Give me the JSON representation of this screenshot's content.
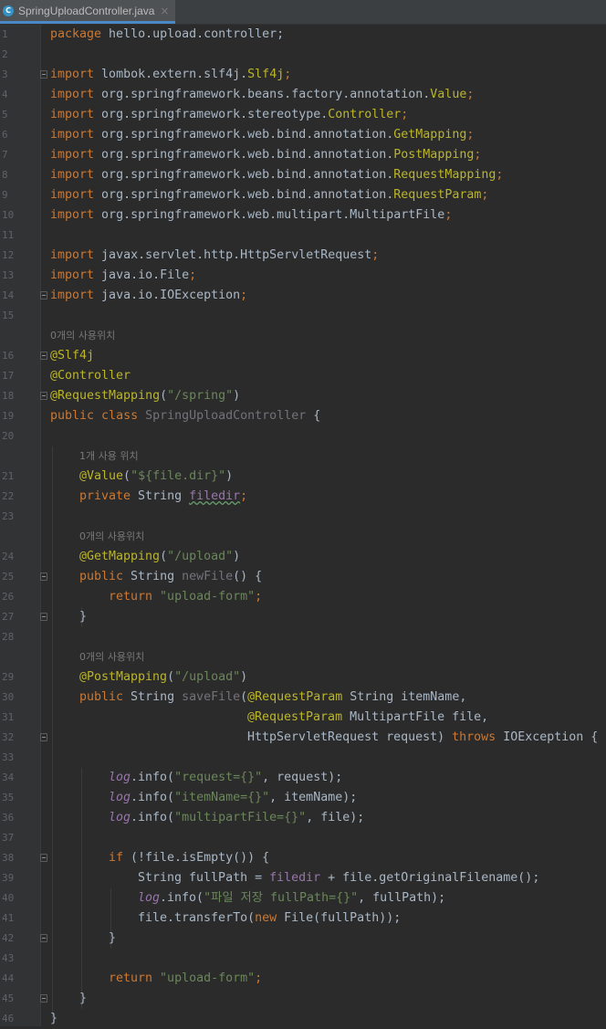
{
  "tab": {
    "filename": "SpringUploadController.java",
    "close": "×"
  },
  "hints": {
    "class_usages": "0개의 사용위치",
    "filedir_usages": "1개 사용 위치",
    "newfile_usages": "0개의 사용위치",
    "savefile_usages": "0개의 사용위치"
  },
  "lines": [
    "1",
    "2",
    "3",
    "4",
    "5",
    "6",
    "7",
    "8",
    "9",
    "10",
    "11",
    "12",
    "13",
    "14",
    "15",
    "16",
    "17",
    "18",
    "19",
    "20",
    "21",
    "22",
    "23",
    "24",
    "25",
    "26",
    "27",
    "28",
    "29",
    "30",
    "31",
    "32",
    "33",
    "34",
    "35",
    "36",
    "37",
    "38",
    "39",
    "40",
    "41",
    "42",
    "43",
    "44",
    "45",
    "46"
  ],
  "code": {
    "package_kw": "package",
    "package_name": " hello.upload.controller;",
    "imports": [
      {
        "kw": "import",
        "path": " lombok.extern.slf4j.",
        "cls": "Slf4j",
        "end": ";"
      },
      {
        "kw": "import",
        "path": " org.springframework.beans.factory.annotation.",
        "cls": "Value",
        "end": ";"
      },
      {
        "kw": "import",
        "path": " org.springframework.stereotype.",
        "cls": "Controller",
        "end": ";"
      },
      {
        "kw": "import",
        "path": " org.springframework.web.bind.annotation.",
        "cls": "GetMapping",
        "end": ";"
      },
      {
        "kw": "import",
        "path": " org.springframework.web.bind.annotation.",
        "cls": "PostMapping",
        "end": ";"
      },
      {
        "kw": "import",
        "path": " org.springframework.web.bind.annotation.",
        "cls": "RequestMapping",
        "end": ";"
      },
      {
        "kw": "import",
        "path": " org.springframework.web.bind.annotation.",
        "cls": "RequestParam",
        "end": ";"
      },
      {
        "kw": "import",
        "path": " org.springframework.web.multipart.MultipartFile",
        "cls": "",
        "end": ";"
      },
      {
        "kw": "import",
        "path": " javax.servlet.http.HttpServletRequest",
        "cls": "",
        "end": ";"
      },
      {
        "kw": "import",
        "path": " java.io.File",
        "cls": "",
        "end": ";"
      },
      {
        "kw": "import",
        "path": " java.io.IOException",
        "cls": "",
        "end": ";"
      }
    ],
    "ann_slf4j": "@Slf4j",
    "ann_controller": "@Controller",
    "ann_reqmap": "@RequestMapping",
    "reqmap_open": "(",
    "reqmap_str": "\"/spring\"",
    "reqmap_close": ")",
    "kw_public": "public",
    "kw_class": " class ",
    "class_name": "SpringUploadController",
    "class_open": " {",
    "ann_value": "@Value",
    "value_open": "(",
    "value_str": "\"${file.dir}\"",
    "value_close": ")",
    "kw_private": "private",
    "type_string": " String ",
    "field_filedir": "filedir",
    "semi": ";",
    "ann_get": "@GetMapping",
    "get_open": "(",
    "get_str": "\"/upload\"",
    "get_close": ")",
    "newfile_public": "public",
    "newfile_type": " String ",
    "newfile_name": "newFile",
    "newfile_rest": "() {",
    "kw_return": "return",
    "return_str": " \"upload-form\"",
    "return_semi": ";",
    "close_brace": "}",
    "ann_post": "@PostMapping",
    "post_open": "(",
    "post_str": "\"/upload\"",
    "post_close": ")",
    "savefile_public": "public",
    "savefile_type": " String ",
    "savefile_name": "saveFile",
    "savefile_paren": "(",
    "ann_reqparam": "@RequestParam",
    "param1_rest": " String itemName,",
    "ann_reqparam2": "@RequestParam",
    "param2_rest": " MultipartFile file,",
    "param3": "HttpServletRequest request) ",
    "kw_throws": "throws",
    "throws_rest": " IOException {",
    "log": "log",
    "info_call": ".info(",
    "log1_str": "\"request={}\"",
    "log1_rest": ", request);",
    "log2_str": "\"itemName={}\"",
    "log2_rest": ", itemName);",
    "log3_str": "\"multipartFile={}\"",
    "log3_rest": ", file);",
    "kw_if": "if",
    "if_rest": " (!file.isEmpty()) {",
    "fullpath_decl": "String fullPath = ",
    "fullpath_field": "filedir",
    "fullpath_rest": " + file.getOriginalFilename();",
    "log4_str": "\"파일 저장 fullPath={}\"",
    "log4_rest": ", fullPath);",
    "transfer_a": "file.transferTo(",
    "kw_new": "new",
    "transfer_b": " File(fullPath));",
    "return2_kw": "return",
    "return2_str": " \"upload-form\"",
    "return2_semi": ";"
  },
  "colors": {
    "background": "#2b2b2b",
    "keyword": "#cc7832",
    "annotation": "#bbb529",
    "string": "#6a8759",
    "field": "#9876aa",
    "method": "#ffc66d",
    "text": "#a9b7c6"
  }
}
